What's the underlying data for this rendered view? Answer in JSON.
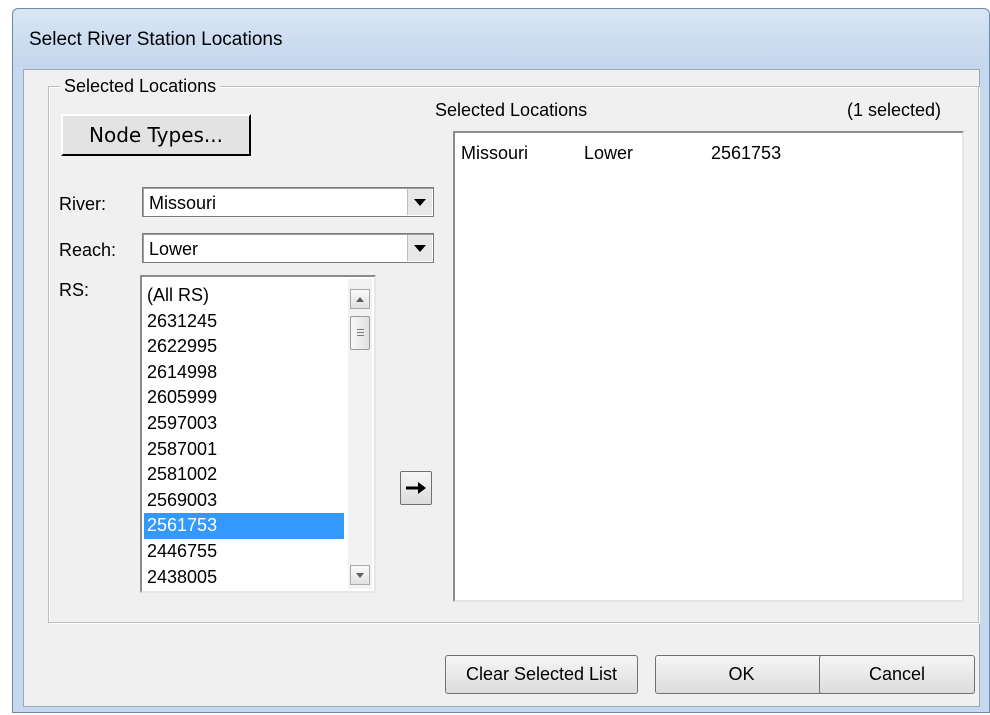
{
  "window": {
    "title": "Select River Station Locations"
  },
  "group": {
    "legend": "Selected Locations"
  },
  "node_types_button": "Node Types...",
  "river": {
    "label": "River:",
    "value": "Missouri"
  },
  "reach": {
    "label": "Reach:",
    "value": "Lower"
  },
  "rs": {
    "label": "RS:",
    "items": [
      "(All RS)",
      "2631245",
      "2622995",
      "2614998",
      "2605999",
      "2597003",
      "2587001",
      "2581002",
      "2569003",
      "2561753",
      "2446755",
      "2438005"
    ],
    "selected": "2561753"
  },
  "selected_list": {
    "header": "Selected Locations",
    "count_text": "(1 selected)",
    "rows": [
      {
        "river": "Missouri",
        "reach": "Lower",
        "rs": "2561753"
      }
    ]
  },
  "buttons": {
    "clear": "Clear Selected List",
    "ok": "OK",
    "cancel": "Cancel"
  },
  "icons": {
    "move_arrow": "right-arrow-icon"
  }
}
